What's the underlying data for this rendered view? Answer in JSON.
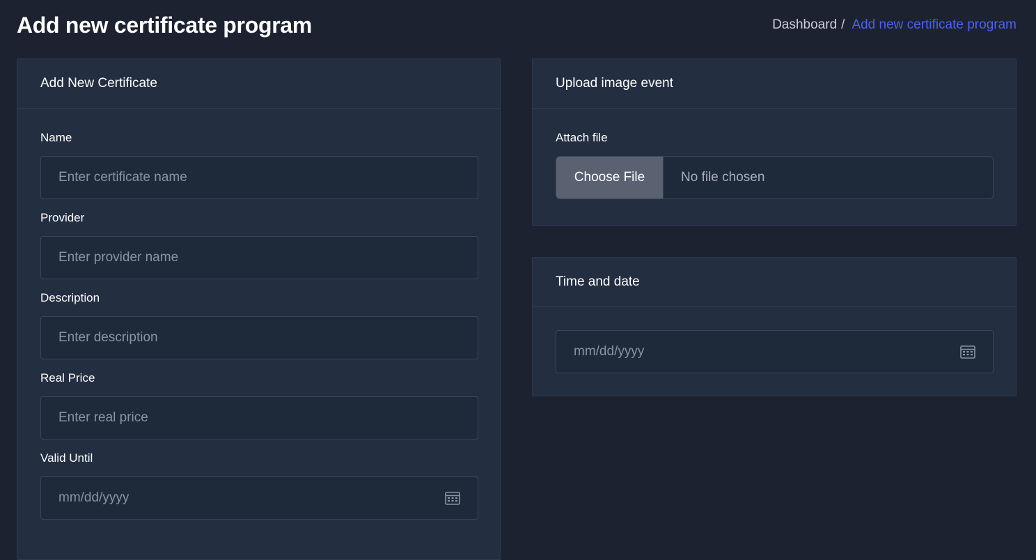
{
  "page": {
    "title": "Add new certificate program"
  },
  "breadcrumb": {
    "home": "Dashboard",
    "separator": "/",
    "current": "Add new certificate program"
  },
  "certificate_form": {
    "heading": "Add New Certificate",
    "fields": {
      "name": {
        "label": "Name",
        "placeholder": "Enter certificate name",
        "value": ""
      },
      "provider": {
        "label": "Provider",
        "placeholder": "Enter provider name",
        "value": ""
      },
      "description": {
        "label": "Description",
        "placeholder": "Enter description",
        "value": ""
      },
      "real_price": {
        "label": "Real Price",
        "placeholder": "Enter real price",
        "value": ""
      },
      "valid_until": {
        "label": "Valid Until",
        "placeholder": "mm/dd/yyyy",
        "value": "",
        "icon": "calendar-icon"
      }
    }
  },
  "upload_card": {
    "heading": "Upload image event",
    "label": "Attach file",
    "button_label": "Choose File",
    "status": "No file chosen"
  },
  "datetime_card": {
    "heading": "Time and date",
    "placeholder": "mm/dd/yyyy",
    "icon": "calendar-icon"
  },
  "colors": {
    "background": "#1c2230",
    "card": "#232e41",
    "input": "#1e293a",
    "accent": "#4a63f0",
    "button": "#5a6272"
  }
}
